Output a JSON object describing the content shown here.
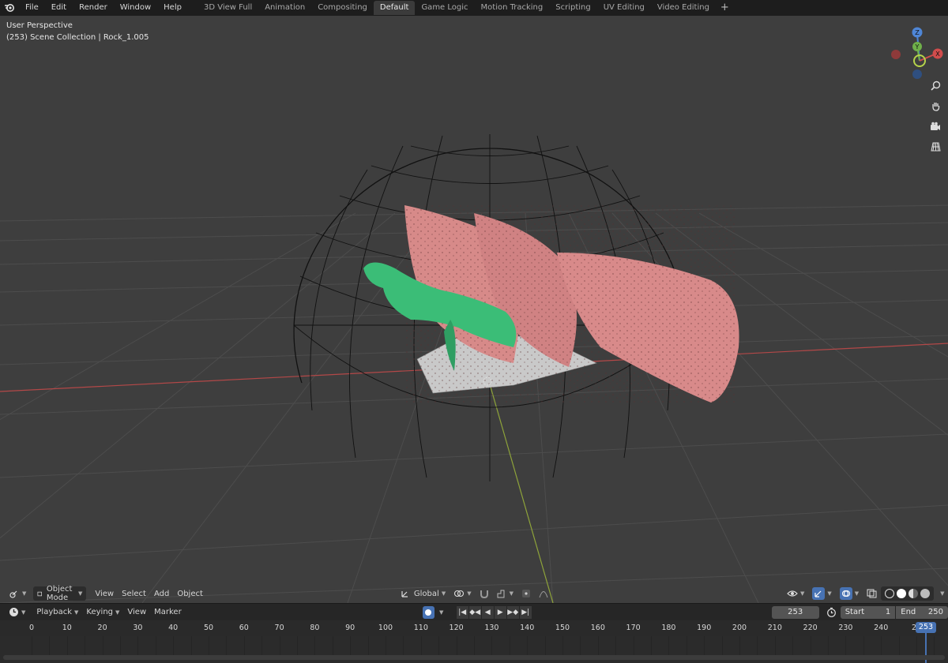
{
  "topbar": {
    "menus": [
      "File",
      "Edit",
      "Render",
      "Window",
      "Help"
    ],
    "workspaces": [
      "3D View Full",
      "Animation",
      "Compositing",
      "Default",
      "Game Logic",
      "Motion Tracking",
      "Scripting",
      "UV Editing",
      "Video Editing"
    ],
    "active_workspace": "Default",
    "add_label": "+"
  },
  "viewport": {
    "perspective_label": "User Perspective",
    "collection_label": "(253) Scene Collection | Rock_1.005",
    "gizmo_axes": {
      "z": "Z",
      "y": "Y",
      "x": "X"
    }
  },
  "viewport_header": {
    "mode": "Object Mode",
    "menus": [
      "View",
      "Select",
      "Add",
      "Object"
    ],
    "orientation": "Global"
  },
  "timeline": {
    "menus": [
      "Playback",
      "Keying",
      "View",
      "Marker"
    ],
    "current_frame": "253",
    "start_label": "Start",
    "start_value": "1",
    "end_label": "End",
    "end_value": "250",
    "ruler_ticks": [
      "0",
      "10",
      "20",
      "30",
      "40",
      "50",
      "60",
      "70",
      "80",
      "90",
      "100",
      "110",
      "120",
      "130",
      "140",
      "150",
      "160",
      "170",
      "180",
      "190",
      "200",
      "210",
      "220",
      "230",
      "240",
      "25"
    ],
    "playhead_label": "253"
  },
  "colors": {
    "accent": "#4772b3",
    "pink_shape": "#d88a8a",
    "green_shape": "#3bbd77",
    "axis_x": "#c24848",
    "axis_y": "#8ea33a"
  }
}
